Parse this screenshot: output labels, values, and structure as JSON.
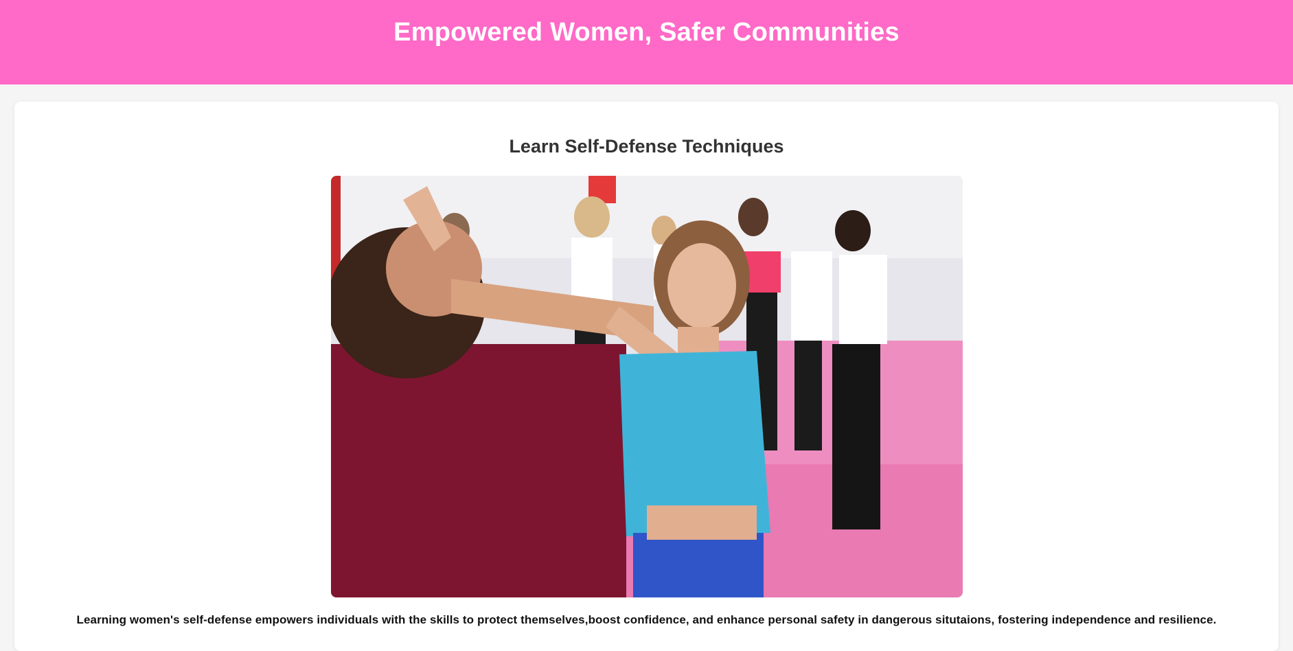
{
  "header": {
    "title": "Empowered Women, Safer Communities"
  },
  "main": {
    "heading": "Learn Self-Defense Techniques",
    "image": {
      "alt": "Woman practicing a self-defense block against a man in a class",
      "icon": "photo"
    },
    "description": "Learning women's self-defense empowers individuals with the skills to protect themselves,boost confidence, and enhance personal safety in dangerous situtaions, fostering independence and resilience."
  },
  "colors": {
    "header_bg": "#ff69c7",
    "page_bg": "#f5f5f5",
    "card_bg": "#ffffff",
    "heading_text": "#333333"
  }
}
